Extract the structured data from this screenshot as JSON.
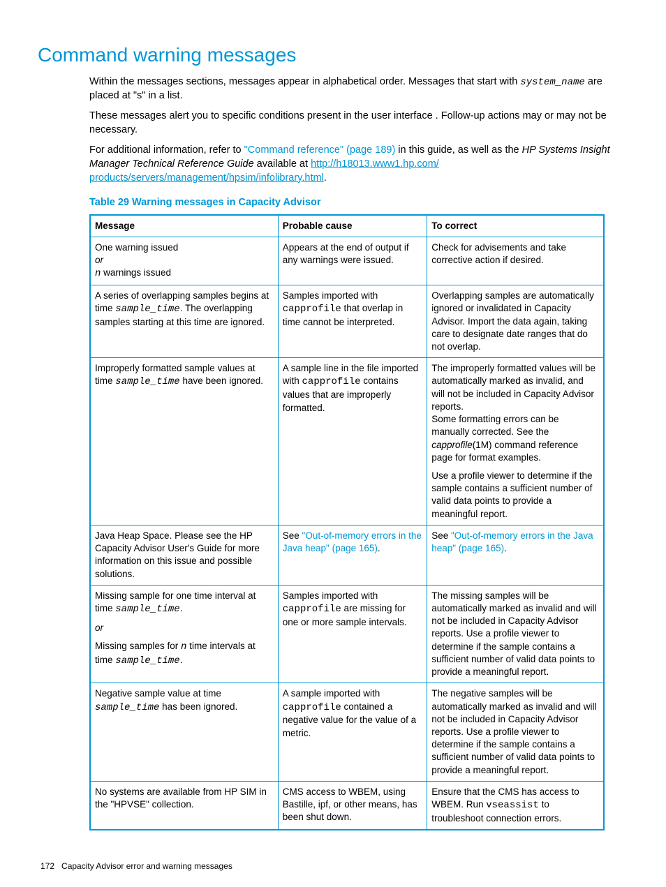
{
  "heading": "Command warning messages",
  "intro1_a": "Within the messages sections, messages appear in alphabetical order. Messages that start with ",
  "intro1_code": "system_name",
  "intro1_b": " are placed at \"s\" in a list.",
  "intro2": "These messages alert you to specific conditions present in the user interface . Follow-up actions may or may not be necessary.",
  "intro3_a": "For additional information, refer to ",
  "intro3_link1": "\"Command reference\" (page 189)",
  "intro3_b": " in this guide, as well as the ",
  "intro3_italic": "HP Systems Insight Manager Technical Reference Guide",
  "intro3_c": " available at ",
  "intro3_url1": "http://h18013.www1.hp.com/",
  "intro3_url2": "products/servers/management/hpsim/infolibrary.html",
  "intro3_d": ".",
  "table_title": "Table 29 Warning messages in Capacity Advisor",
  "headers": {
    "c1": "Message",
    "c2": "Probable cause",
    "c3": "To correct"
  },
  "rows": {
    "r1": {
      "msg_line1": "One warning issued",
      "msg_or": "or",
      "msg_n": "n",
      "msg_line2_tail": "  warnings issued",
      "cause": "Appears at the end of output if any warnings were issued.",
      "correct": "Check for advisements and take corrective action if desired."
    },
    "r2": {
      "msg_a": "A series of overlapping samples begins at time ",
      "msg_code": "sample_time",
      "msg_b": ".  The overlapping samples starting at this time are ignored.",
      "cause_a": "Samples imported with ",
      "cause_code": "capprofile",
      "cause_b": " that overlap in time cannot be interpreted.",
      "correct": "Overlapping samples are automatically ignored or invalidated in Capacity Advisor. Import the data again, taking care to designate date ranges that do not overlap."
    },
    "r3": {
      "msg_a": "Improperly formatted sample values at time ",
      "msg_code": "sample_time",
      "msg_b": " have been ignored.",
      "cause_a": "A sample line in the file imported with ",
      "cause_code": "capprofile",
      "cause_b": " contains values that are improperly formatted.",
      "correct_p1_a": "The improperly formatted values will be automatically marked as invalid, and will not be included in Capacity Advisor reports.",
      "correct_p1_b": "Some formatting errors can be manually corrected. See the ",
      "correct_italic": "capprofile",
      "correct_p1_c": "(1M) command reference page for format examples.",
      "correct_p2": "Use a profile viewer to determine if the sample contains a sufficient number of valid data points to provide a meaningful report."
    },
    "r4": {
      "msg": "Java Heap Space. Please see the HP Capacity Advisor User's Guide for more information on this issue and possible solutions.",
      "cause_a": "See ",
      "cause_link": "\"Out-of-memory errors in the Java heap\" (page 165)",
      "cause_b": ".",
      "correct_a": "See ",
      "correct_link": "\"Out-of-memory errors in the Java heap\" (page 165)",
      "correct_b": "."
    },
    "r5": {
      "msg_a": "Missing sample for one time interval at time ",
      "msg_code1": "sample_time",
      "msg_b": ".",
      "msg_or": "or",
      "msg_c": "Missing samples for ",
      "msg_n": "n",
      "msg_d": " time intervals at time ",
      "msg_code2": "sample_time",
      "msg_e": ".",
      "cause_a": "Samples imported with ",
      "cause_code": "capprofile",
      "cause_b": " are missing for one or more sample intervals.",
      "correct": "The missing samples will be automatically marked as invalid and will not be included in Capacity Advisor reports. Use a profile viewer to determine if the sample contains a sufficient number of valid data points to provide a meaningful report."
    },
    "r6": {
      "msg_a": "Negative sample value at time ",
      "msg_code": "sample_time",
      "msg_b": " has been ignored.",
      "cause_a": "A sample imported with ",
      "cause_code": "capprofile",
      "cause_b": " contained a negative value for the value of a metric.",
      "correct": "The negative samples will be automatically marked as invalid and will not be included in Capacity Advisor reports. Use a profile viewer to determine if the sample contains a sufficient number of valid data points to provide a meaningful report."
    },
    "r7": {
      "msg": "No systems are available from HP SIM in the \"HPVSE\" collection.",
      "cause": "CMS access to WBEM, using Bastille, ipf, or other means, has been shut down.",
      "correct_a": "Ensure that the CMS has access to WBEM. Run ",
      "correct_code": "vseassist",
      "correct_b": " to troubleshoot connection errors."
    }
  },
  "footer_page": "172",
  "footer_text": "Capacity Advisor error and warning messages"
}
